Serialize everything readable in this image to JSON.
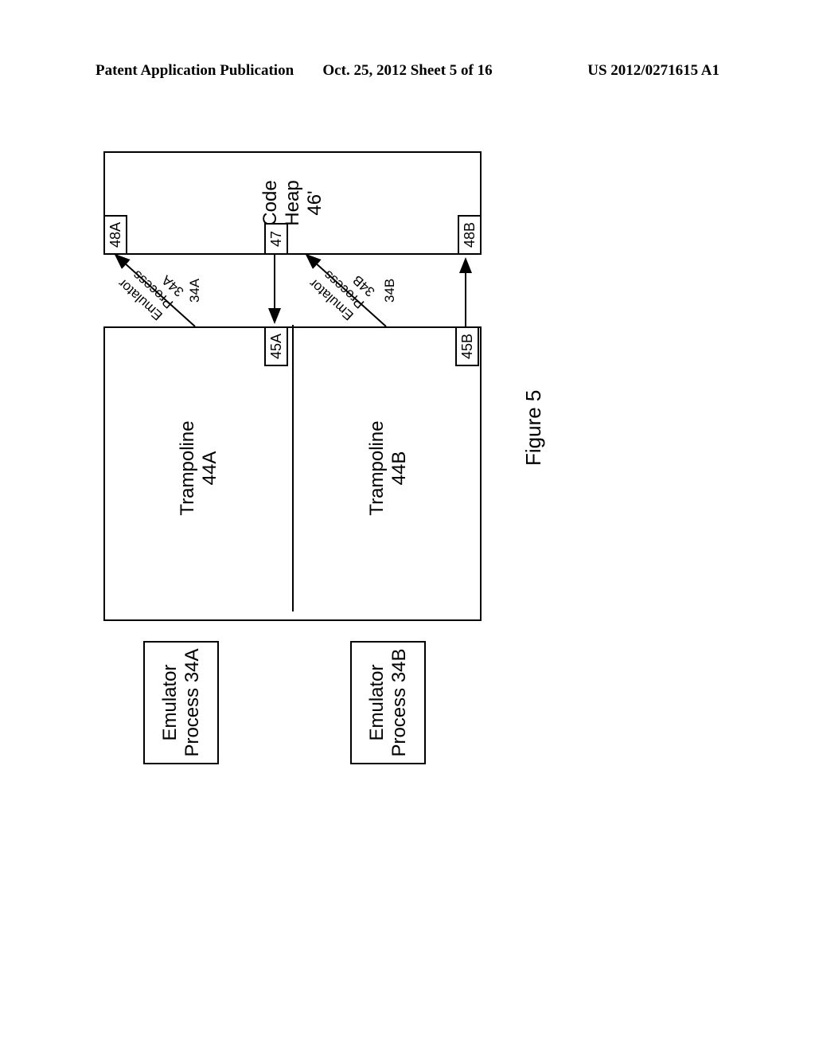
{
  "header": {
    "left": "Patent Application Publication",
    "center": "Oct. 25, 2012  Sheet 5 of 16",
    "right": "US 2012/0271615 A1"
  },
  "emulator_a": {
    "line1": "Emulator",
    "line2": "Process 34A"
  },
  "emulator_b": {
    "line1": "Emulator",
    "line2": "Process 34B"
  },
  "trampoline_a": {
    "line1": "Trampoline",
    "line2": "44A"
  },
  "trampoline_b": {
    "line1": "Trampoline",
    "line2": "44B"
  },
  "ports": {
    "p45a": "45A",
    "p45b": "45B",
    "p48a": "48A",
    "p47": "47",
    "p48b": "48B"
  },
  "code_heap": {
    "line1": "Code",
    "line2": "Heap",
    "line3": "46'"
  },
  "arrow_labels": {
    "diag_a_line1": "Emulator",
    "diag_a_line2": "Process",
    "diag_a_line3": "34A",
    "below_a": "34A",
    "diag_b_line1": "Emulator",
    "diag_b_line2": "Process",
    "diag_b_line3": "34B",
    "below_b": "34B"
  },
  "figure_caption": "Figure 5"
}
